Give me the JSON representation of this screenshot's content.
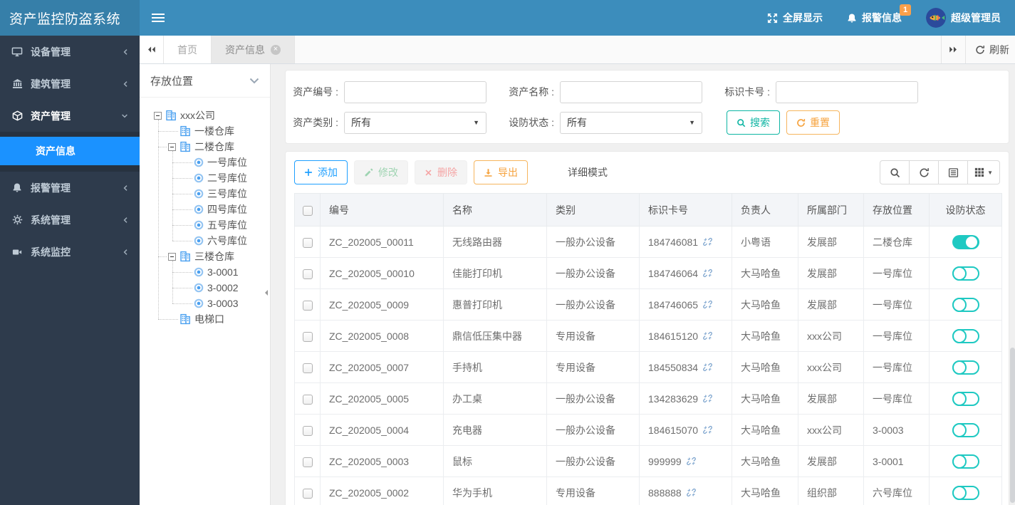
{
  "app": {
    "title": "资产监控防盗系统"
  },
  "header": {
    "fullscreen_label": "全屏显示",
    "alarm_label": "报警信息",
    "alarm_badge": "1",
    "username": "超级管理员"
  },
  "sidebar": {
    "items": [
      {
        "key": "device",
        "label": "设备管理",
        "icon": "monitor",
        "state": "collapsed"
      },
      {
        "key": "building",
        "label": "建筑管理",
        "icon": "bank",
        "state": "collapsed"
      },
      {
        "key": "asset",
        "label": "资产管理",
        "icon": "cube",
        "state": "expanded",
        "children": [
          {
            "key": "asset-info",
            "label": "资产信息",
            "active": true
          }
        ]
      },
      {
        "key": "alarm",
        "label": "报警管理",
        "icon": "bell",
        "state": "collapsed"
      },
      {
        "key": "system",
        "label": "系统管理",
        "icon": "gear",
        "state": "collapsed"
      },
      {
        "key": "monitoring",
        "label": "系统监控",
        "icon": "camera",
        "state": "collapsed"
      }
    ]
  },
  "tabs": {
    "items": [
      {
        "label": "首页",
        "active": false,
        "closable": false
      },
      {
        "label": "资产信息",
        "active": true,
        "closable": true
      }
    ],
    "refresh_label": "刷新"
  },
  "tree": {
    "title": "存放位置",
    "nodes": [
      {
        "label": "xxx公司",
        "level": 0,
        "icon": "building",
        "expander": true
      },
      {
        "label": "一楼仓库",
        "level": 1,
        "icon": "building",
        "expander": false
      },
      {
        "label": "二楼仓库",
        "level": 1,
        "icon": "building",
        "expander": true
      },
      {
        "label": "一号库位",
        "level": 2,
        "icon": "radio",
        "expander": false
      },
      {
        "label": "二号库位",
        "level": 2,
        "icon": "radio",
        "expander": false
      },
      {
        "label": "三号库位",
        "level": 2,
        "icon": "radio",
        "expander": false
      },
      {
        "label": "四号库位",
        "level": 2,
        "icon": "radio",
        "expander": false
      },
      {
        "label": "五号库位",
        "level": 2,
        "icon": "radio",
        "expander": false
      },
      {
        "label": "六号库位",
        "level": 2,
        "icon": "radio",
        "expander": false
      },
      {
        "label": "三楼仓库",
        "level": 1,
        "icon": "building",
        "expander": true
      },
      {
        "label": "3-0001",
        "level": 2,
        "icon": "radio",
        "expander": false
      },
      {
        "label": "3-0002",
        "level": 2,
        "icon": "radio",
        "expander": false
      },
      {
        "label": "3-0003",
        "level": 2,
        "icon": "radio",
        "expander": false
      },
      {
        "label": "电梯口",
        "level": 1,
        "icon": "building",
        "expander": false
      }
    ]
  },
  "search": {
    "fields": [
      {
        "label": "资产编号 :",
        "type": "input",
        "value": ""
      },
      {
        "label": "资产名称 :",
        "type": "input",
        "value": ""
      },
      {
        "label": "标识卡号 :",
        "type": "input",
        "value": ""
      },
      {
        "label": "资产类别 :",
        "type": "select",
        "value": "所有"
      },
      {
        "label": "设防状态 :",
        "type": "select",
        "value": "所有"
      }
    ],
    "search_btn": "搜索",
    "reset_btn": "重置"
  },
  "toolbar": {
    "add": "添加",
    "edit": "修改",
    "delete": "删除",
    "export": "导出",
    "mode_label": "详细模式"
  },
  "table": {
    "columns": [
      "编号",
      "名称",
      "类别",
      "标识卡号",
      "负责人",
      "所属部门",
      "存放位置",
      "设防状态"
    ],
    "rows": [
      {
        "id": "ZC_202005_00011",
        "name": "无线路由器",
        "category": "一般办公设备",
        "card": "184746081",
        "owner": "小粤语",
        "dept": "发展部",
        "location": "二楼仓库",
        "armed": true
      },
      {
        "id": "ZC_202005_00010",
        "name": "佳能打印机",
        "category": "一般办公设备",
        "card": "184746064",
        "owner": "大马哈鱼",
        "dept": "发展部",
        "location": "一号库位",
        "armed": false
      },
      {
        "id": "ZC_202005_0009",
        "name": "惠普打印机",
        "category": "一般办公设备",
        "card": "184746065",
        "owner": "大马哈鱼",
        "dept": "发展部",
        "location": "一号库位",
        "armed": false
      },
      {
        "id": "ZC_202005_0008",
        "name": "鼎信低压集中器",
        "category": "专用设备",
        "card": "184615120",
        "owner": "大马哈鱼",
        "dept": "xxx公司",
        "location": "一号库位",
        "armed": false
      },
      {
        "id": "ZC_202005_0007",
        "name": "手持机",
        "category": "专用设备",
        "card": "184550834",
        "owner": "大马哈鱼",
        "dept": "xxx公司",
        "location": "一号库位",
        "armed": false
      },
      {
        "id": "ZC_202005_0005",
        "name": "办工桌",
        "category": "一般办公设备",
        "card": "134283629",
        "owner": "大马哈鱼",
        "dept": "发展部",
        "location": "一号库位",
        "armed": false
      },
      {
        "id": "ZC_202005_0004",
        "name": "充电器",
        "category": "一般办公设备",
        "card": "184615070",
        "owner": "大马哈鱼",
        "dept": "xxx公司",
        "location": "3-0003",
        "armed": false
      },
      {
        "id": "ZC_202005_0003",
        "name": "鼠标",
        "category": "一般办公设备",
        "card": "999999",
        "owner": "大马哈鱼",
        "dept": "发展部",
        "location": "3-0001",
        "armed": false
      },
      {
        "id": "ZC_202005_0002",
        "name": "华为手机",
        "category": "专用设备",
        "card": "888888",
        "owner": "大马哈鱼",
        "dept": "组织部",
        "location": "六号库位",
        "armed": false
      }
    ]
  },
  "colors": {
    "header_bg": "#3c8dbc",
    "logo_bg": "#367fa9",
    "sidebar_bg": "#2e3b4c",
    "active_menu": "#1b92ff",
    "toggle_on": "#1fc9c2",
    "accent_teal": "#0eb5a3",
    "accent_orange": "#f6a23c",
    "accent_blue": "#1e9fff",
    "badge_bg": "#f9a04b"
  }
}
